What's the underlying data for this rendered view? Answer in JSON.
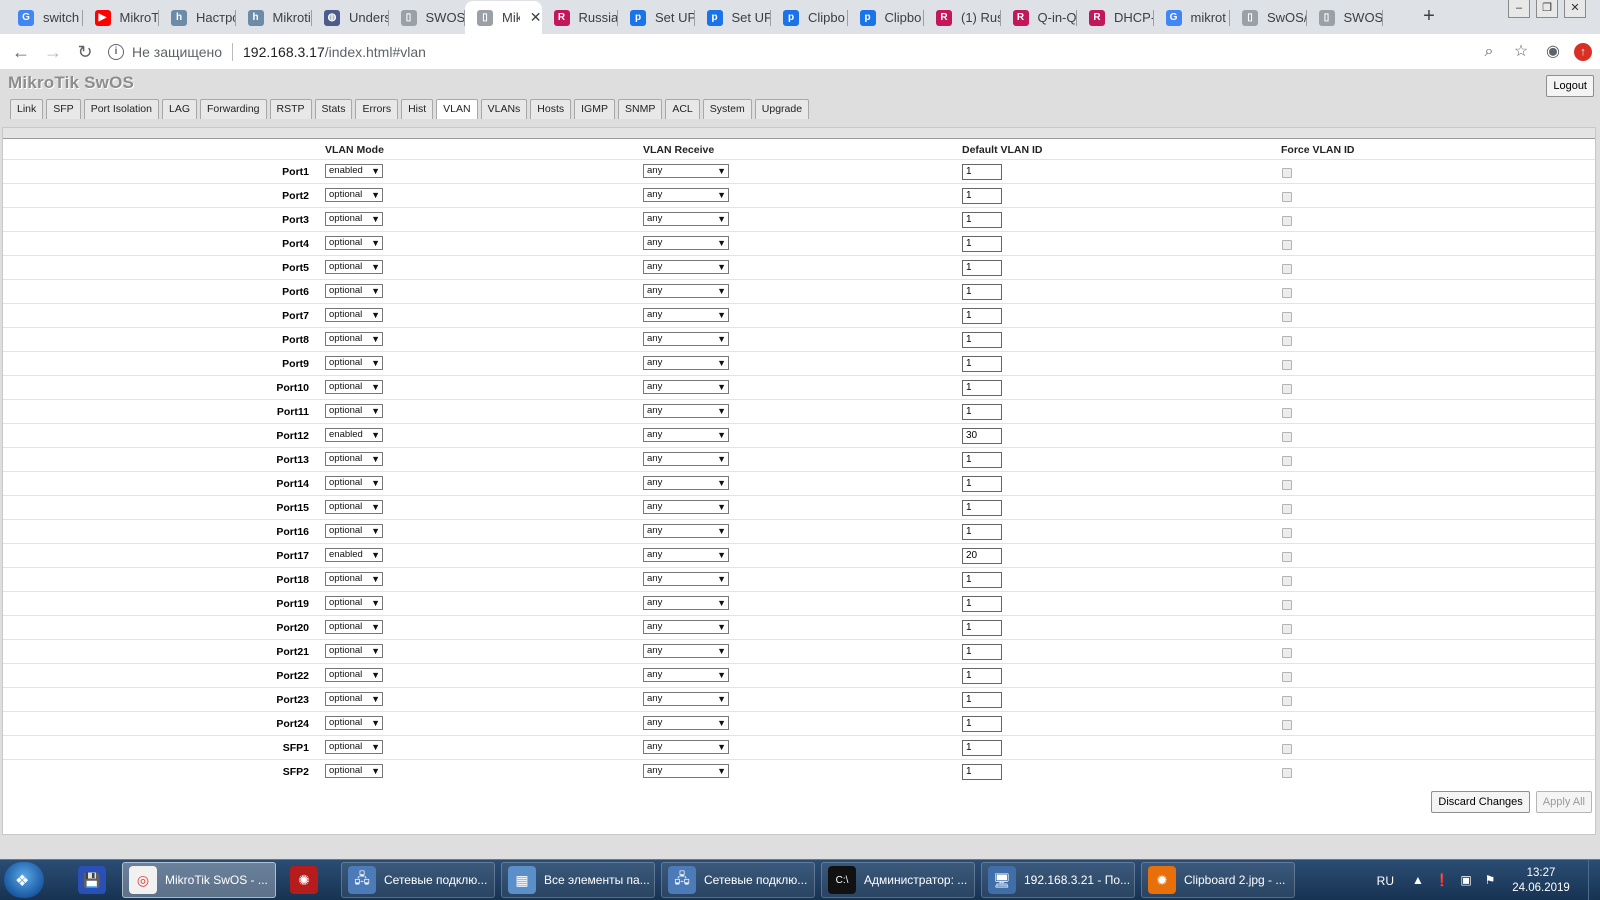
{
  "browser": {
    "tabs": [
      {
        "title": "switch",
        "icon": "google-icon",
        "color": "#4285f4"
      },
      {
        "title": "MikroT",
        "icon": "youtube-icon",
        "color": "#ff0000"
      },
      {
        "title": "Настро",
        "icon": "habr-icon",
        "color": "#6c8ba6"
      },
      {
        "title": "Mikroti",
        "icon": "habr-icon",
        "color": "#6c8ba6"
      },
      {
        "title": "Unders",
        "icon": "globe-icon",
        "color": "#4a5b8c"
      },
      {
        "title": "SWOS/",
        "icon": "page-icon",
        "color": "#9aa0a6"
      },
      {
        "title": "Mik",
        "icon": "page-icon",
        "color": "#9aa0a6"
      },
      {
        "title": "Russian",
        "icon": "rum-icon",
        "color": "#c2185b"
      },
      {
        "title": "Set UP",
        "icon": "p-icon",
        "color": "#1a73e8"
      },
      {
        "title": "Set UP",
        "icon": "p-icon",
        "color": "#1a73e8"
      },
      {
        "title": "Clipbo",
        "icon": "p-icon",
        "color": "#1a73e8"
      },
      {
        "title": "Clipbo",
        "icon": "p-icon",
        "color": "#1a73e8"
      },
      {
        "title": "(1) Rus",
        "icon": "rum-icon",
        "color": "#c2185b"
      },
      {
        "title": "Q-in-Q",
        "icon": "rum-icon",
        "color": "#c2185b"
      },
      {
        "title": "DHCP-",
        "icon": "rum-icon",
        "color": "#c2185b"
      },
      {
        "title": "mikrot",
        "icon": "google-icon",
        "color": "#4285f4"
      },
      {
        "title": "SwOS/",
        "icon": "page-icon",
        "color": "#9aa0a6"
      },
      {
        "title": "SWOS/",
        "icon": "page-icon",
        "color": "#9aa0a6"
      }
    ],
    "active_tab": 6,
    "address": {
      "insecure_label": "Не защищено",
      "host": "192.168.3.17",
      "path": "/index.html#vlan"
    }
  },
  "app": {
    "brand": "MikroTik SwOS",
    "logout_label": "Logout",
    "menu": [
      "Link",
      "SFP",
      "Port Isolation",
      "LAG",
      "Forwarding",
      "RSTP",
      "Stats",
      "Errors",
      "Hist",
      "VLAN",
      "VLANs",
      "Hosts",
      "IGMP",
      "SNMP",
      "ACL",
      "System",
      "Upgrade"
    ],
    "active_menu": "VLAN",
    "columns": {
      "mode": "VLAN Mode",
      "receive": "VLAN Receive",
      "default_id": "Default VLAN ID",
      "force": "Force VLAN ID"
    },
    "ports": [
      {
        "name": "Port1",
        "mode": "enabled",
        "receive": "any",
        "vid": "1",
        "force": false
      },
      {
        "name": "Port2",
        "mode": "optional",
        "receive": "any",
        "vid": "1",
        "force": false
      },
      {
        "name": "Port3",
        "mode": "optional",
        "receive": "any",
        "vid": "1",
        "force": false
      },
      {
        "name": "Port4",
        "mode": "optional",
        "receive": "any",
        "vid": "1",
        "force": false
      },
      {
        "name": "Port5",
        "mode": "optional",
        "receive": "any",
        "vid": "1",
        "force": false
      },
      {
        "name": "Port6",
        "mode": "optional",
        "receive": "any",
        "vid": "1",
        "force": false
      },
      {
        "name": "Port7",
        "mode": "optional",
        "receive": "any",
        "vid": "1",
        "force": false
      },
      {
        "name": "Port8",
        "mode": "optional",
        "receive": "any",
        "vid": "1",
        "force": false
      },
      {
        "name": "Port9",
        "mode": "optional",
        "receive": "any",
        "vid": "1",
        "force": false
      },
      {
        "name": "Port10",
        "mode": "optional",
        "receive": "any",
        "vid": "1",
        "force": false
      },
      {
        "name": "Port11",
        "mode": "optional",
        "receive": "any",
        "vid": "1",
        "force": false
      },
      {
        "name": "Port12",
        "mode": "enabled",
        "receive": "any",
        "vid": "30",
        "force": false
      },
      {
        "name": "Port13",
        "mode": "optional",
        "receive": "any",
        "vid": "1",
        "force": false
      },
      {
        "name": "Port14",
        "mode": "optional",
        "receive": "any",
        "vid": "1",
        "force": false
      },
      {
        "name": "Port15",
        "mode": "optional",
        "receive": "any",
        "vid": "1",
        "force": false
      },
      {
        "name": "Port16",
        "mode": "optional",
        "receive": "any",
        "vid": "1",
        "force": false
      },
      {
        "name": "Port17",
        "mode": "enabled",
        "receive": "any",
        "vid": "20",
        "force": false
      },
      {
        "name": "Port18",
        "mode": "optional",
        "receive": "any",
        "vid": "1",
        "force": false
      },
      {
        "name": "Port19",
        "mode": "optional",
        "receive": "any",
        "vid": "1",
        "force": false
      },
      {
        "name": "Port20",
        "mode": "optional",
        "receive": "any",
        "vid": "1",
        "force": false
      },
      {
        "name": "Port21",
        "mode": "optional",
        "receive": "any",
        "vid": "1",
        "force": false
      },
      {
        "name": "Port22",
        "mode": "optional",
        "receive": "any",
        "vid": "1",
        "force": false
      },
      {
        "name": "Port23",
        "mode": "optional",
        "receive": "any",
        "vid": "1",
        "force": false
      },
      {
        "name": "Port24",
        "mode": "optional",
        "receive": "any",
        "vid": "1",
        "force": false
      },
      {
        "name": "SFP1",
        "mode": "optional",
        "receive": "any",
        "vid": "1",
        "force": false
      },
      {
        "name": "SFP2",
        "mode": "optional",
        "receive": "any",
        "vid": "1",
        "force": false
      }
    ],
    "discard_label": "Discard Changes",
    "apply_label": "Apply All"
  },
  "taskbar": {
    "items": [
      {
        "kind": "icon",
        "icon": "save-icon"
      },
      {
        "kind": "button",
        "icon": "chrome-icon",
        "label": "MikroTik SwOS - ...",
        "active": true
      },
      {
        "kind": "icon",
        "icon": "app-icon"
      },
      {
        "kind": "button",
        "icon": "network-icon",
        "label": "Сетевые подклю..."
      },
      {
        "kind": "button",
        "icon": "control-panel-icon",
        "label": "Все элементы па..."
      },
      {
        "kind": "button",
        "icon": "network-icon",
        "label": "Сетевые подклю..."
      },
      {
        "kind": "button",
        "icon": "cmd-icon",
        "label": "Администратор: ..."
      },
      {
        "kind": "button",
        "icon": "remote-desktop-icon",
        "label": "192.168.3.21 - По..."
      },
      {
        "kind": "button",
        "icon": "image-viewer-icon",
        "label": "Clipboard 2.jpg - ..."
      }
    ],
    "language": "RU",
    "time": "13:27",
    "date": "24.06.2019"
  }
}
